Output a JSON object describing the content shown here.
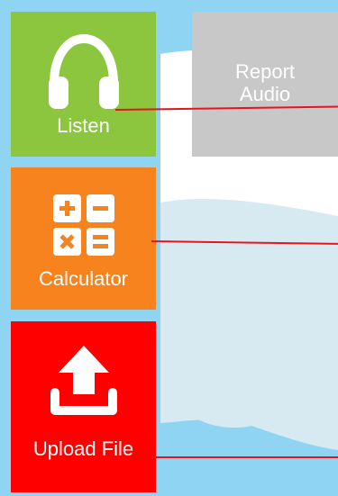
{
  "tiles": {
    "listen": {
      "label": "Listen",
      "icon": "headphones-icon"
    },
    "report_audio": {
      "label": "Report Audio"
    },
    "calculator": {
      "label": "Calculator",
      "icon": "calculator-icon"
    },
    "upload_file": {
      "label": "Upload File",
      "icon": "upload-icon"
    }
  },
  "colors": {
    "background": "#8fd4f2",
    "cloud": "#d7eaf2",
    "cloud_white": "#ffffff",
    "listen": "#8cc63f",
    "report_audio": "#c8c8c8",
    "calculator": "#f7831f",
    "upload_file": "#ff0000",
    "pointer_line": "#e8141c"
  }
}
